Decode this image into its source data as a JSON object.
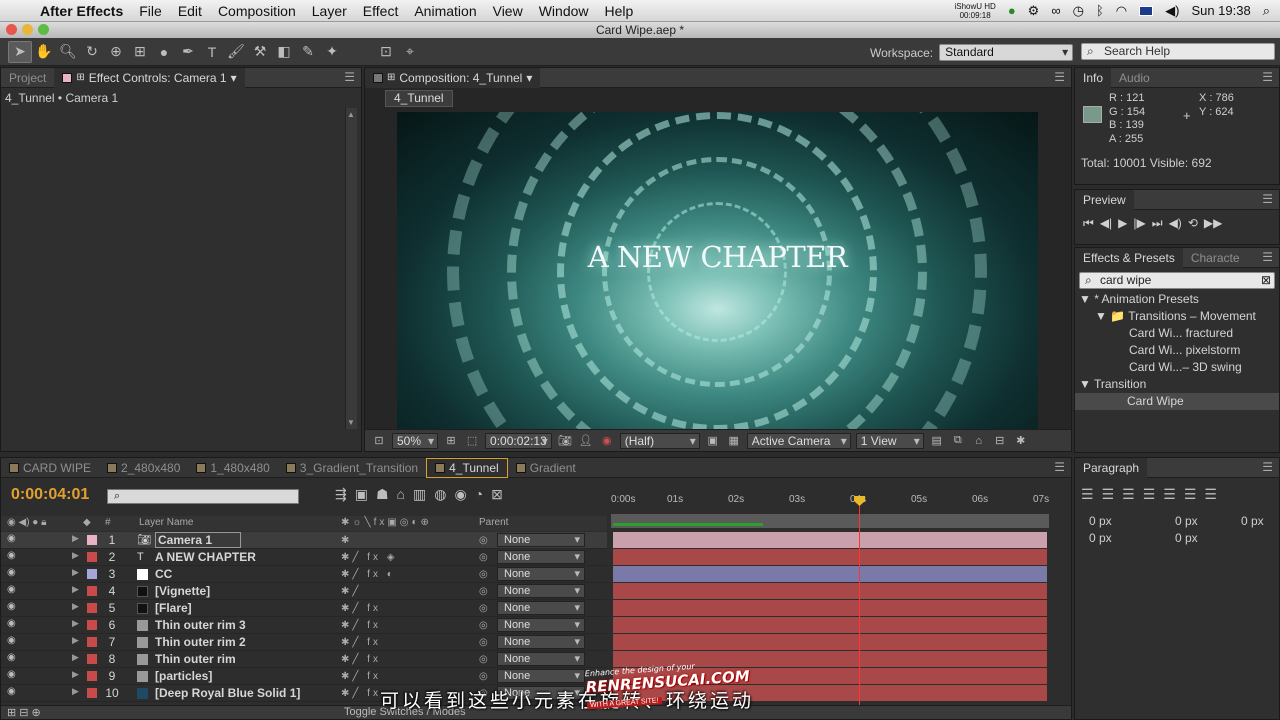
{
  "menubar": {
    "app": "After Effects",
    "items": [
      "File",
      "Edit",
      "Composition",
      "Layer",
      "Effect",
      "Animation",
      "View",
      "Window",
      "Help"
    ],
    "ishow_line1": "iShowU HD",
    "ishow_line2": "00:09:18",
    "clock": "Sun 19:38"
  },
  "window": {
    "title": "Card Wipe.aep *"
  },
  "workspace": {
    "label": "Workspace:",
    "value": "Standard"
  },
  "help_search": {
    "placeholder": "Search Help"
  },
  "left_panel": {
    "tabs": [
      "Project",
      "Effect Controls: Camera 1"
    ],
    "breadcrumb": "4_Tunnel • Camera 1"
  },
  "composition": {
    "tab": "Composition: 4_Tunnel",
    "name_chip": "4_Tunnel",
    "title_text": "A NEW CHAPTER",
    "zoom": "50%",
    "timecode": "0:00:02:13",
    "resolution": "(Half)",
    "camera": "Active Camera",
    "views": "1 View"
  },
  "info": {
    "tabs": [
      "Info",
      "Audio"
    ],
    "r": "R : 121",
    "g": "G : 154",
    "b": "B : 139",
    "a": "A : 255",
    "x": "X : 786",
    "y": "Y : 624",
    "total": "Total: 10001   Visible: 692"
  },
  "preview": {
    "tab": "Preview"
  },
  "effects": {
    "tabs": [
      "Effects & Presets",
      "Characte"
    ],
    "search_value": "card wipe",
    "tree": [
      "▼ * Animation Presets",
      "▼ 📁 Transitions – Movement",
      "Card Wi... fractured",
      "Card Wi... pixelstorm",
      "Card Wi...– 3D swing",
      "▼ Transition",
      "Card Wipe"
    ]
  },
  "paragraph": {
    "tab": "Paragraph",
    "px1": "0 px",
    "px2": "0 px",
    "px3": "0 px",
    "px4": "0 px",
    "px5": "0 px"
  },
  "timeline": {
    "tabs": [
      "CARD WIPE",
      "2_480x480",
      "1_480x480",
      "3_Gradient_Transition",
      "4_Tunnel",
      "Gradient"
    ],
    "current_time": "0:00:04:01",
    "header_hash": "#",
    "header_layer": "Layer Name",
    "header_parent": "Parent",
    "ruler": [
      "0:00s",
      "01s",
      "02s",
      "03s",
      "04s",
      "05s",
      "06s",
      "07s"
    ],
    "layers": [
      {
        "num": "1",
        "name": "Camera 1",
        "color": "#e8b4c4",
        "parent": "None"
      },
      {
        "num": "2",
        "name": "A NEW CHAPTER",
        "color": "#c84a4a",
        "parent": "None"
      },
      {
        "num": "3",
        "name": "CC",
        "color": "#a6a6d8",
        "parent": "None"
      },
      {
        "num": "4",
        "name": "[Vignette]",
        "color": "#c84a4a",
        "parent": "None"
      },
      {
        "num": "5",
        "name": "[Flare]",
        "color": "#c84a4a",
        "parent": "None"
      },
      {
        "num": "6",
        "name": "Thin outer rim 3",
        "color": "#c84a4a",
        "parent": "None"
      },
      {
        "num": "7",
        "name": "Thin outer rim 2",
        "color": "#c84a4a",
        "parent": "None"
      },
      {
        "num": "8",
        "name": "Thin outer rim",
        "color": "#c84a4a",
        "parent": "None"
      },
      {
        "num": "9",
        "name": "[particles]",
        "color": "#c84a4a",
        "parent": "None"
      },
      {
        "num": "10",
        "name": "[Deep Royal Blue Solid 1]",
        "color": "#c84a4a",
        "parent": "None"
      }
    ],
    "toggle_label": "Toggle Switches / Modes"
  },
  "subtitle": "可以看到这些小元素在旋转、环绕运动",
  "watermark": {
    "line1": "Enhance the design of your",
    "line2": "RENRENSUCAI.COM",
    "line3": "WITH A GREAT SITE!"
  },
  "colors": {
    "accent": "#e2a02f",
    "playhead": "#ff3333",
    "bar_red": "#a84848",
    "bar_pink": "#c9a0ac",
    "bar_blue": "#7a7aa8"
  }
}
